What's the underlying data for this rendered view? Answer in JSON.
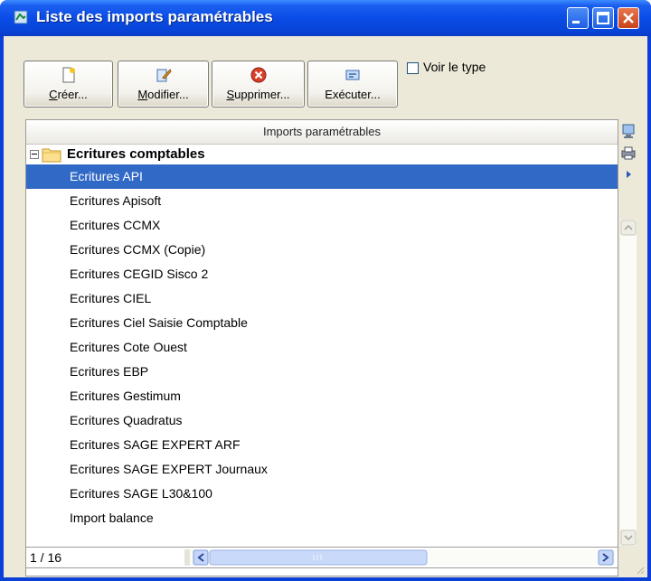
{
  "window": {
    "title": "Liste des imports paramétrables"
  },
  "toolbar": {
    "create_label_u": "C",
    "create_label_rest": "réer...",
    "modify_label_u": "M",
    "modify_label_rest": "odifier...",
    "delete_label_u": "S",
    "delete_label_rest": "upprimer...",
    "execute_label": "Exécuter...",
    "show_type_label": "Voir le type",
    "show_type_checked": false
  },
  "table": {
    "header": "Imports paramétrables",
    "group": {
      "label": "Ecritures comptables",
      "expanded": true
    },
    "rows": [
      "Ecritures API",
      "Ecritures Apisoft",
      "Ecritures CCMX",
      "Ecritures CCMX (Copie)",
      "Ecritures CEGID Sisco 2",
      "Ecritures CIEL",
      "Ecritures Ciel Saisie Comptable",
      "Ecritures Cote Ouest",
      "Ecritures EBP",
      "Ecritures Gestimum",
      "Ecritures Quadratus",
      "Ecritures SAGE EXPERT ARF",
      "Ecritures SAGE EXPERT Journaux",
      "Ecritures SAGE L30&100",
      "Import balance"
    ],
    "selected_index": 0
  },
  "status": {
    "record_count": "1 / 16"
  },
  "colors": {
    "selection": "#3169c6",
    "titlebar": "#0a4ce6"
  }
}
